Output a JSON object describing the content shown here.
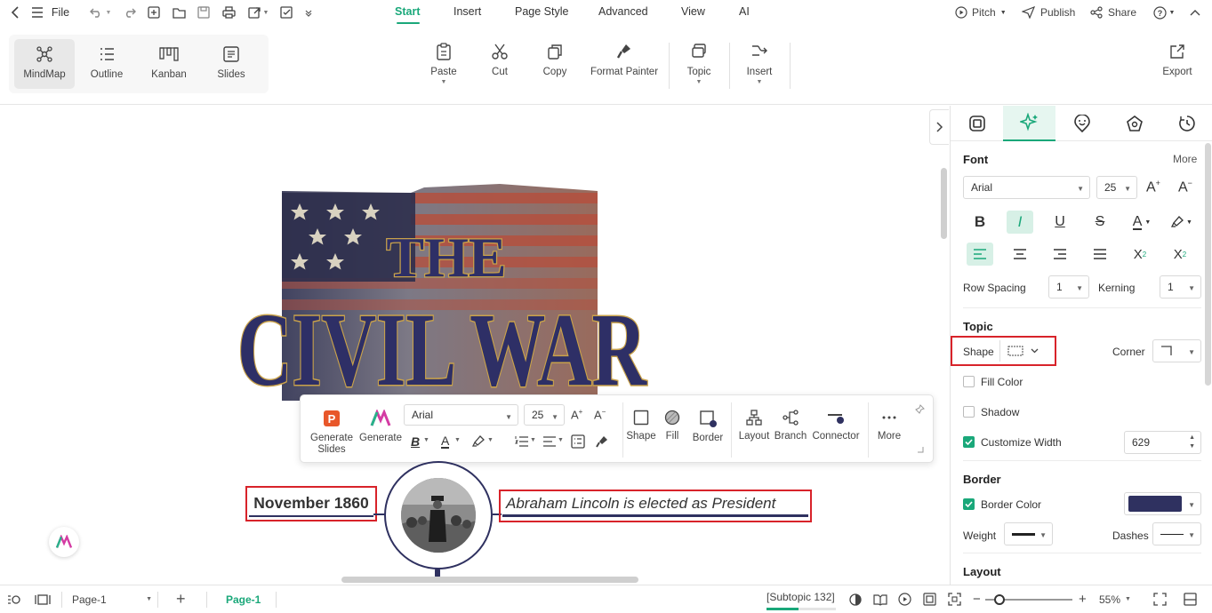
{
  "topbar": {
    "file_label": "File",
    "tabs": [
      {
        "label": "Start",
        "active": true
      },
      {
        "label": "Insert",
        "active": false
      },
      {
        "label": "Page Style",
        "active": false
      },
      {
        "label": "Advanced",
        "active": false
      },
      {
        "label": "View",
        "active": false
      },
      {
        "label": "AI",
        "active": false
      }
    ],
    "pitch_label": "Pitch",
    "publish_label": "Publish",
    "share_label": "Share"
  },
  "ribbon": {
    "views": [
      {
        "label": "MindMap",
        "icon": "mindmap-icon",
        "active": true
      },
      {
        "label": "Outline",
        "icon": "outline-icon",
        "active": false
      },
      {
        "label": "Kanban",
        "icon": "kanban-icon",
        "active": false
      },
      {
        "label": "Slides",
        "icon": "slides-icon",
        "active": false
      }
    ],
    "paste_label": "Paste",
    "cut_label": "Cut",
    "copy_label": "Copy",
    "format_painter_label": "Format Painter",
    "topic_label": "Topic",
    "insert_label": "Insert",
    "export_label": "Export"
  },
  "floating_toolbar": {
    "generate_slides_label": "Generate Slides",
    "generate_label": "Generate",
    "font_value": "Arial",
    "size_value": "25",
    "shape_label": "Shape",
    "fill_label": "Fill",
    "border_label": "Border",
    "layout_label": "Layout",
    "branch_label": "Branch",
    "connector_label": "Connector",
    "more_label": "More"
  },
  "canvas": {
    "banner_text_top": "THE",
    "banner_text_main": "CIVIL WAR",
    "date_topic": "November 1860",
    "event_topic": "Abraham Lincoln is elected as President"
  },
  "panel": {
    "font_section": "Font",
    "more_label": "More",
    "font_value": "Arial",
    "size_value": "25",
    "row_spacing_label": "Row Spacing",
    "row_spacing_value": "1",
    "kerning_label": "Kerning",
    "kerning_value": "1",
    "topic_section": "Topic",
    "shape_label": "Shape",
    "corner_label": "Corner",
    "fill_color_label": "Fill Color",
    "fill_color_checked": false,
    "shadow_label": "Shadow",
    "shadow_checked": false,
    "customize_width_label": "Customize Width",
    "customize_width_checked": true,
    "customize_width_value": "629",
    "border_section": "Border",
    "border_color_label": "Border Color",
    "border_color_checked": true,
    "border_color_value": "#2f3160",
    "weight_label": "Weight",
    "dashes_label": "Dashes",
    "layout_section": "Layout"
  },
  "status": {
    "page_select": "Page-1",
    "active_page_tab": "Page-1",
    "selection_info": "[Subtopic 132]",
    "zoom_value": "55%"
  },
  "colors": {
    "accent": "#1aa87a",
    "highlight": "#d8232a",
    "topic_line": "#2f3160"
  }
}
